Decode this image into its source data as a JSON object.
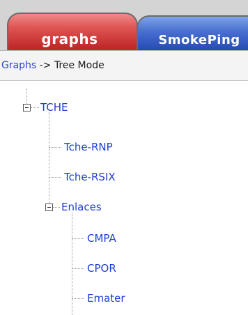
{
  "tabs": [
    {
      "label": "graphs",
      "active": true,
      "color": "#c22a2a"
    },
    {
      "label": "SmokePing",
      "active": false,
      "color": "#2246b0"
    }
  ],
  "breadcrumb": {
    "root_link": "Graphs",
    "separator": " -> ",
    "current": "Tree Mode"
  },
  "tree": {
    "root": {
      "label": "TCHE",
      "expanded": true
    },
    "children": [
      {
        "label": "Tche-RNP"
      },
      {
        "label": "Tche-RSIX"
      },
      {
        "label": "Enlaces",
        "expanded": true,
        "children": [
          {
            "label": "CMPA"
          },
          {
            "label": "CPOR"
          },
          {
            "label": "Emater"
          }
        ]
      }
    ]
  },
  "colors": {
    "link": "#1e3fcf",
    "breadcrumb_link": "#2b46c9",
    "tab_bar_bg": "#d4d4d4"
  }
}
